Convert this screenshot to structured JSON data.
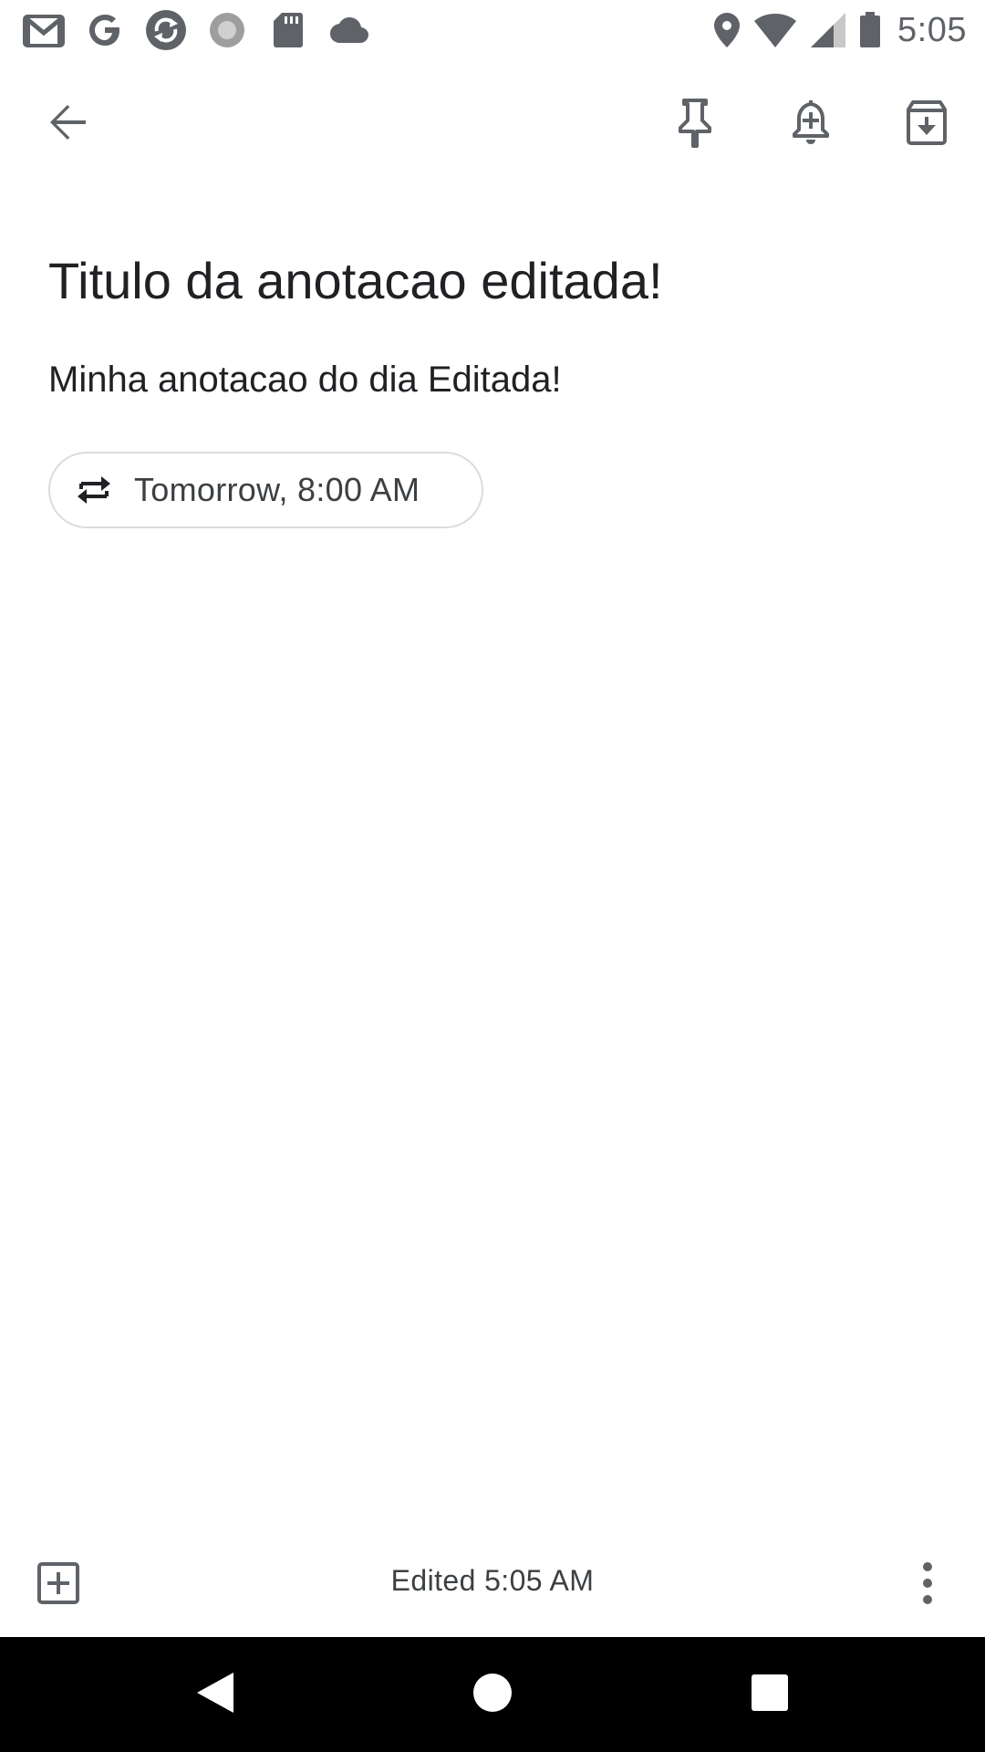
{
  "status_bar": {
    "time": "5:05",
    "left_icons": [
      "gmail-icon",
      "google-icon",
      "sync-icon",
      "circle-icon",
      "sd-card-icon",
      "cloud-icon"
    ],
    "right_icons": [
      "location-icon",
      "wifi-icon",
      "cellular-icon",
      "battery-icon"
    ]
  },
  "toolbar": {
    "back_icon": "arrow-back-icon",
    "pin_icon": "pin-icon",
    "reminder_icon": "add-alert-icon",
    "archive_icon": "archive-icon"
  },
  "note": {
    "title": "Titulo da anotacao editada!",
    "body": "Minha anotacao do dia Editada!",
    "reminder_label": "Tomorrow, 8:00 AM",
    "reminder_icon": "repeat-icon"
  },
  "bottom_bar": {
    "edited_text": "Edited 5:05 AM",
    "add_icon": "add-box-icon",
    "more_icon": "more-vert-icon"
  },
  "nav_bar": {
    "back_icon": "nav-back-icon",
    "home_icon": "nav-home-icon",
    "recents_icon": "nav-recents-icon"
  },
  "colors": {
    "icon_gray": "#5f6368",
    "text_primary": "#202124",
    "chip_border": "#dadce0",
    "nav_bar": "#000000"
  }
}
